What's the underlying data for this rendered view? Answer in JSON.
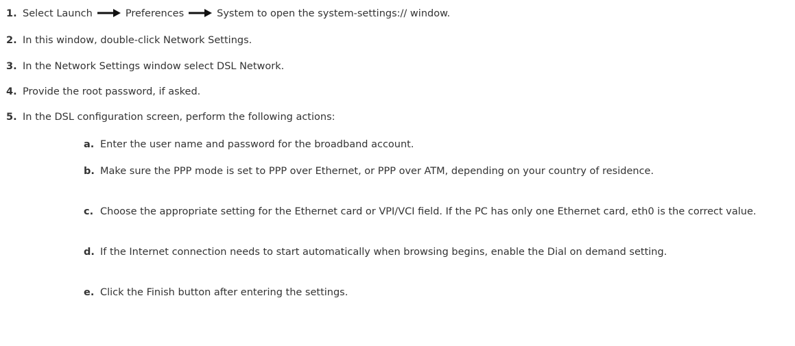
{
  "steps": [
    {
      "num": "1.",
      "parts": [
        "Select Launch",
        "Preferences",
        "System to open the system-settings:// window."
      ]
    },
    {
      "num": "2.",
      "text": "In this window, double-click Network Settings."
    },
    {
      "num": "3.",
      "text": "In the Network Settings window select DSL Network."
    },
    {
      "num": "4.",
      "text": "Provide the root password, if asked."
    },
    {
      "num": "5.",
      "text": "In the DSL configuration screen, perform the following actions:"
    }
  ],
  "substeps": [
    {
      "letter": "a.",
      "text": "Enter the user name and password for the broadband account."
    },
    {
      "letter": "b.",
      "text": "Make sure the PPP mode is set to PPP over Ethernet, or PPP over ATM, depending on your country of residence."
    },
    {
      "letter": "c.",
      "text": "Choose the appropriate setting for the Ethernet card or VPI/VCI field. If the PC has only one Ethernet card, eth0 is the correct value."
    },
    {
      "letter": "d.",
      "text": "If the Internet connection needs to start automatically when browsing begins, enable the Dial on demand setting."
    },
    {
      "letter": "e.",
      "text": "Click the Finish button after entering the settings."
    }
  ],
  "icons": {
    "arrow": "right-arrow-icon"
  }
}
